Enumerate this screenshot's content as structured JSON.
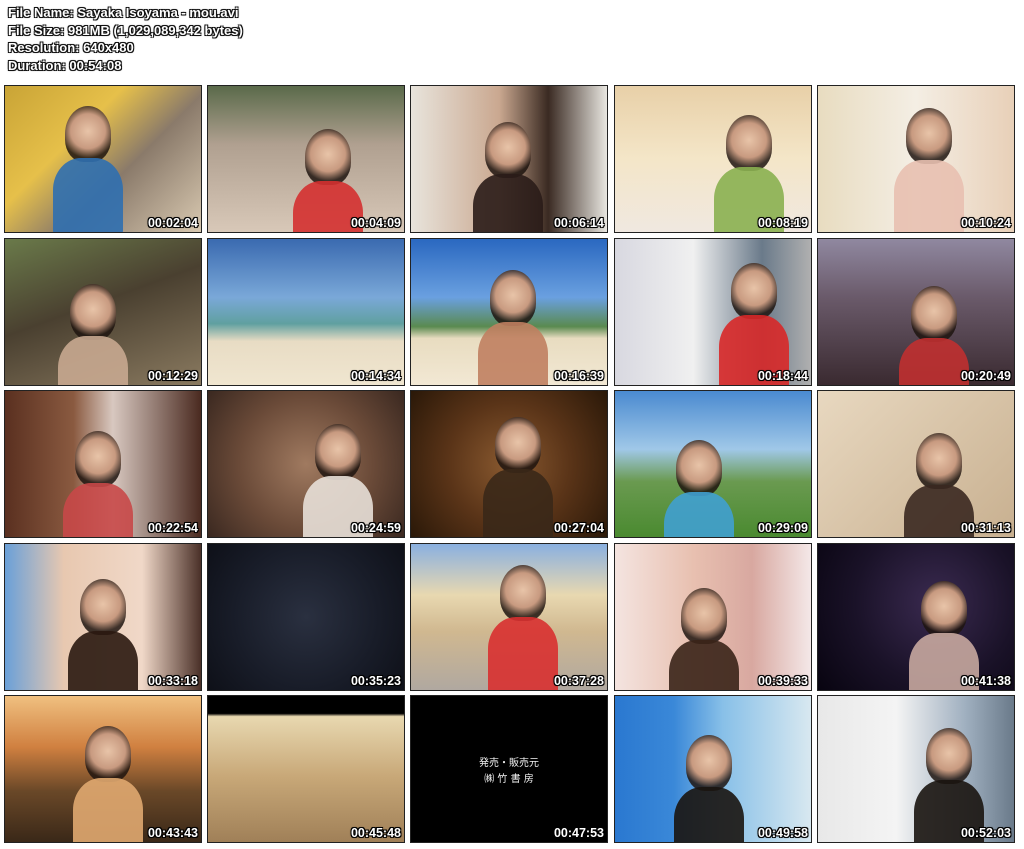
{
  "info": {
    "file_name": "File Name: Sayaka Isoyama - mou.avi",
    "file_size": "File Size: 981MB (1,029,089,342 bytes)",
    "resolution": "Resolution: 640x480",
    "duration": "Duration: 00:54:08"
  },
  "thumbnails": [
    {
      "time": "00:02:04",
      "bg": "linear-gradient(135deg,#c9a436 0%,#e6c04a 35%,#8a7a6a 60%,#d8c8b0 100%)",
      "fig": "#2f6fb0",
      "text": ""
    },
    {
      "time": "00:04:09",
      "bg": "linear-gradient(180deg,#5a6a4a 0%,#b0a090 40%,#d8c8b8 100%)",
      "fig": "#d43030",
      "text": ""
    },
    {
      "time": "00:06:14",
      "bg": "linear-gradient(90deg,#e8e4dc 0%,#caa890 45%,#3a2a22 70%,#e8e6e0 100%)",
      "fig": "#2a1c18",
      "text": ""
    },
    {
      "time": "00:08:19",
      "bg": "linear-gradient(180deg,#e8d0a8 0%,#f4e6c8 50%,#f0e8e0 100%)",
      "fig": "#8ab050",
      "text": ""
    },
    {
      "time": "00:10:24",
      "bg": "linear-gradient(90deg,#e8dcc0 0%,#f4eee4 50%,#e8d0b8 100%)",
      "fig": "#e8c0b0",
      "text": ""
    },
    {
      "time": "00:12:29",
      "bg": "linear-gradient(160deg,#6a7a4a 0%,#4a4030 45%,#8a7a60 100%)",
      "fig": "#c8a890",
      "text": ""
    },
    {
      "time": "00:14:34",
      "bg": "linear-gradient(180deg,#3a6ab0 0%,#7aa8d8 40%,#60a0a0 58%,#e8dcc4 70%,#f0e6d0 100%)",
      "fig": "",
      "text": ""
    },
    {
      "time": "00:16:39",
      "bg": "linear-gradient(180deg,#2a68c0 0%,#6aa0e0 40%,#5a8a50 60%,#e8dcc0 68%,#f2e8d4 100%)",
      "fig": "#c08060",
      "text": ""
    },
    {
      "time": "00:18:44",
      "bg": "linear-gradient(90deg,#d8d8e0 0%,#f0f0f0 40%,#6a7a8a 75%,#b0b0b0 100%)",
      "fig": "#d82828",
      "text": ""
    },
    {
      "time": "00:20:49",
      "bg": "linear-gradient(180deg,#9088a0 0%,#6a5a6a 40%,#3a2a30 100%)",
      "fig": "#c03030",
      "text": ""
    },
    {
      "time": "00:22:54",
      "bg": "linear-gradient(90deg,#5a3020 0%,#8a5a40 35%,#d8c8c0 55%,#4a2a20 100%)",
      "fig": "#c84848",
      "text": ""
    },
    {
      "time": "00:24:59",
      "bg": "radial-gradient(circle at 50% 50%,#a07a60 0%,#6a4a38 55%,#3a2820 100%)",
      "fig": "#e8e0d8",
      "text": ""
    },
    {
      "time": "00:27:04",
      "bg": "radial-gradient(circle at 50% 50%,#8a5a30 0%,#5a3418 50%,#2a1808 100%)",
      "fig": "#3a2818",
      "text": ""
    },
    {
      "time": "00:29:09",
      "bg": "linear-gradient(180deg,#4a8ad0 0%,#a0c8e8 40%,#6a9a50 62%,#4a8a30 100%)",
      "fig": "#40a0d0",
      "text": ""
    },
    {
      "time": "00:31:13",
      "bg": "linear-gradient(135deg,#e8d8c0 0%,#d8c4a8 50%,#c8b090 100%)",
      "fig": "#3a2820",
      "text": ""
    },
    {
      "time": "00:33:18",
      "bg": "linear-gradient(90deg,#6aa0d8 0%,#e8c8b0 30%,#f0d8c8 70%,#4a3028 100%)",
      "fig": "#2a1810",
      "text": ""
    },
    {
      "time": "00:35:23",
      "bg": "radial-gradient(circle at 50% 50%,#2a3040 0%,#181c28 60%,#0e1018 100%)",
      "fig": "",
      "text": ""
    },
    {
      "time": "00:37:28",
      "bg": "linear-gradient(180deg,#8ab0e0 0%,#e8d8b0 35%,#d0b890 60%,#b0a8a0 100%)",
      "fig": "#d83030",
      "text": ""
    },
    {
      "time": "00:39:33",
      "bg": "linear-gradient(90deg,#f4e4e0 0%,#e8c0b0 40%,#d8a8a0 70%,#f4e8e8 100%)",
      "fig": "#3a2418",
      "text": ""
    },
    {
      "time": "00:41:38",
      "bg": "radial-gradient(circle at 60% 40%,#3a2a50 0%,#1a1228 55%,#080410 100%)",
      "fig": "#c8a8a0",
      "text": ""
    },
    {
      "time": "00:43:43",
      "bg": "linear-gradient(180deg,#f0c080 0%,#d08040 35%,#6a4828 65%,#3a2818 100%)",
      "fig": "#e0a870",
      "text": ""
    },
    {
      "time": "00:45:48",
      "bg": "linear-gradient(180deg,#000000 0%,#000000 12%,#e8d8b0 14%,#c8a878 55%,#a08058 100%)",
      "fig": "",
      "text": ""
    },
    {
      "time": "00:47:53",
      "bg": "#000000",
      "fig": "",
      "text": "発売・販売元\n㈱ 竹 書 房"
    },
    {
      "time": "00:49:58",
      "bg": "linear-gradient(90deg,#2a78d0 0%,#3a88d8 30%,#88c0e8 55%,#d8e8f0 100%)",
      "fig": "#1a1410",
      "text": ""
    },
    {
      "time": "00:52:03",
      "bg": "linear-gradient(90deg,#e8e8e8 0%,#f4f4f4 40%,#a0b0c0 75%,#6a7a8a 100%)",
      "fig": "#1a1410",
      "text": ""
    }
  ]
}
